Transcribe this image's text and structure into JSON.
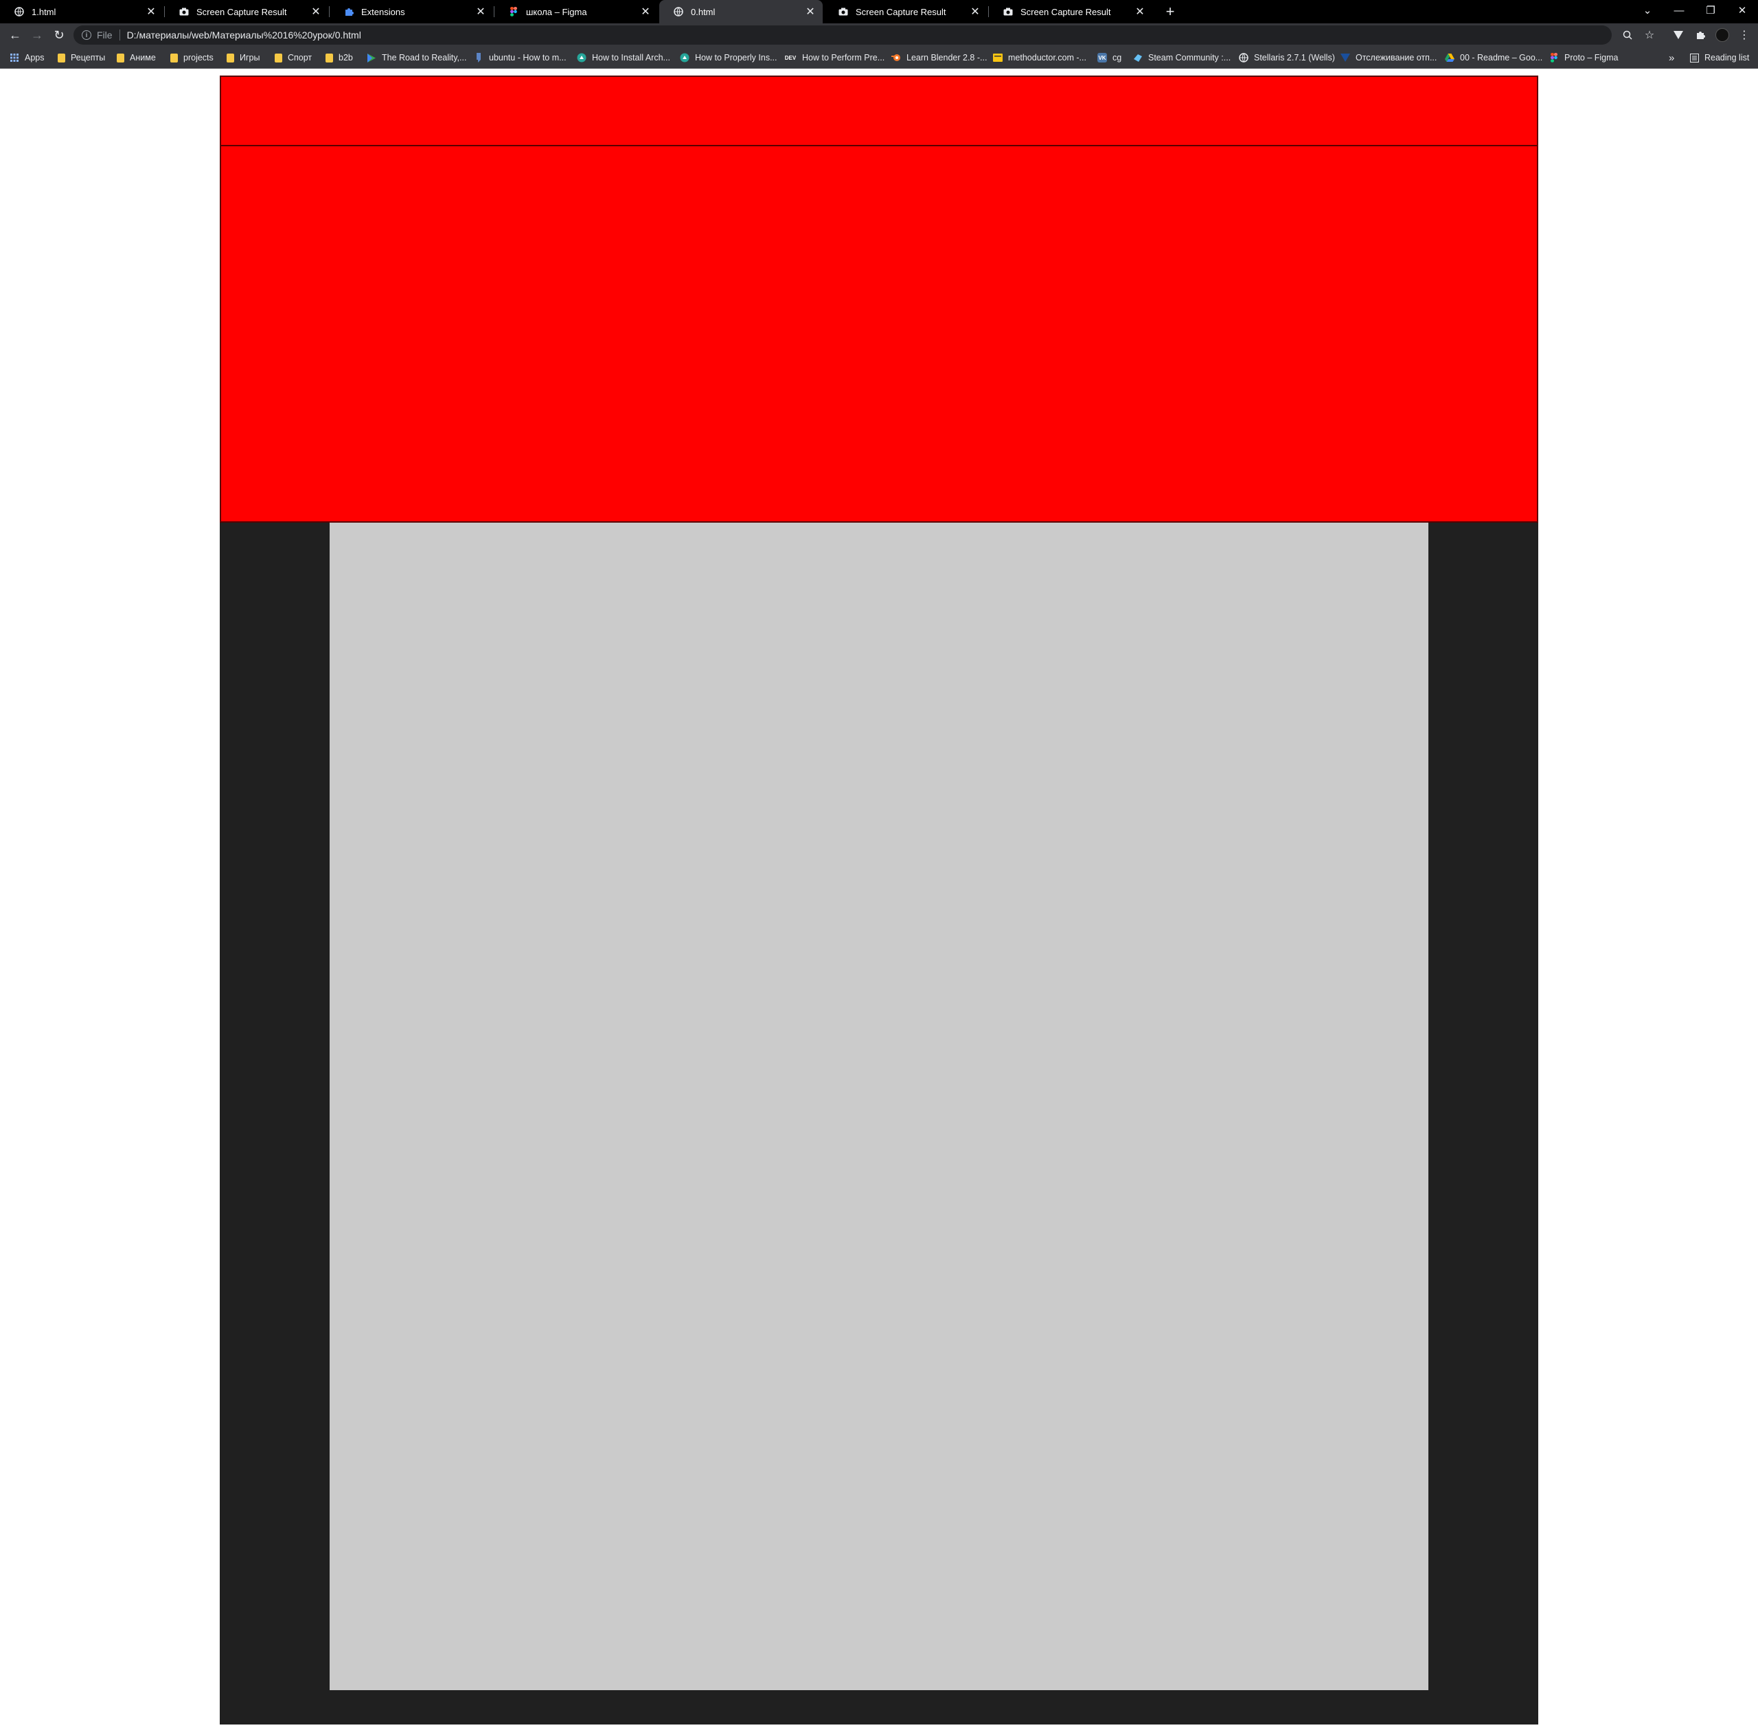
{
  "tabs": [
    {
      "title": "1.html",
      "icon": "globe-icon",
      "active": false
    },
    {
      "title": "Screen Capture Result",
      "icon": "camera-icon",
      "active": false
    },
    {
      "title": "Extensions",
      "icon": "puzzle-icon",
      "active": false
    },
    {
      "title": "школа – Figma",
      "icon": "figma-icon",
      "active": false
    },
    {
      "title": "0.html",
      "icon": "globe-icon",
      "active": true
    },
    {
      "title": "Screen Capture Result",
      "icon": "camera-icon",
      "active": false
    },
    {
      "title": "Screen Capture Result",
      "icon": "camera-icon",
      "active": false
    }
  ],
  "toolbar": {
    "scheme": "File",
    "url": "D:/материалы/web/Материалы%2016%20урок/0.html"
  },
  "bookmarks": [
    {
      "label": "Apps",
      "icon": "apps-grid-icon"
    },
    {
      "label": "Рецепты",
      "icon": "folder-icon"
    },
    {
      "label": "Аниме",
      "icon": "folder-icon"
    },
    {
      "label": "projects",
      "icon": "folder-icon"
    },
    {
      "label": "Игры",
      "icon": "folder-icon"
    },
    {
      "label": "Спорт",
      "icon": "folder-icon"
    },
    {
      "label": "b2b",
      "icon": "folder-icon"
    },
    {
      "label": "The Road to Reality,...",
      "icon": "play-icon"
    },
    {
      "label": "ubuntu - How to m...",
      "icon": "askubuntu-icon"
    },
    {
      "label": "How to Install Arch...",
      "icon": "site-icon"
    },
    {
      "label": "How to Properly Ins...",
      "icon": "site-icon"
    },
    {
      "label": "How to Perform Pre...",
      "icon": "dev-icon"
    },
    {
      "label": "Learn Blender 2.8 -...",
      "icon": "blender-icon"
    },
    {
      "label": "methoductor.com -...",
      "icon": "site-icon"
    },
    {
      "label": "cg",
      "icon": "vk-icon"
    },
    {
      "label": "Steam Community :...",
      "icon": "steam-icon"
    },
    {
      "label": "Stellaris 2.7.1 (Wells)",
      "icon": "globe-icon"
    },
    {
      "label": "Отслеживание отп...",
      "icon": "site-icon"
    },
    {
      "label": "00 - Readme – Goo...",
      "icon": "drive-icon"
    },
    {
      "label": "Proto – Figma",
      "icon": "figma-icon"
    }
  ],
  "overflow_label": "»",
  "reading_list": "Reading list",
  "colors": {
    "header": "#ff0000",
    "wrapper": "#202020",
    "content": "#cbcbcb"
  }
}
